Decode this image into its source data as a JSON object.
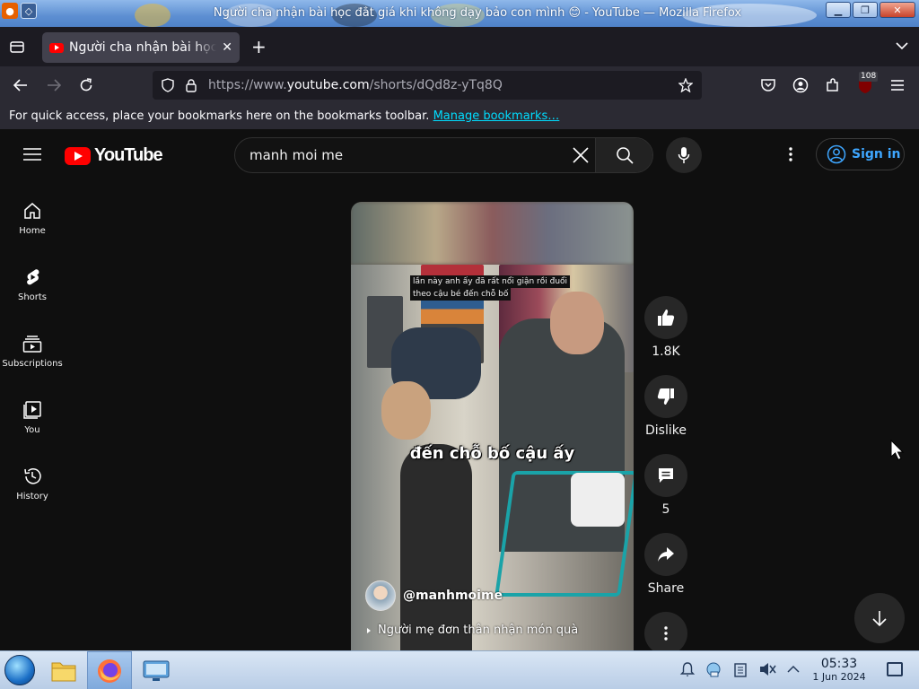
{
  "window": {
    "title": "Người cha nhận bài học đắt giá khi không dạy bảo con mình 😊 - YouTube — Mozilla Firefox"
  },
  "browser": {
    "tab_title": "Người cha nhận bài học đắt giá khi không dạy bảo con mình",
    "url_prefix": "https://www.",
    "url_domain": "youtube.com",
    "url_path": "/shorts/dQd8z-yTq8Q",
    "extensions_badge": "108",
    "bookmarks_message": "For quick access, place your bookmarks here on the bookmarks toolbar.",
    "bookmarks_link": "Manage bookmarks…"
  },
  "youtube": {
    "logo_text": "YouTube",
    "search_query": "manh moi me",
    "sign_in_label": "Sign in",
    "sidebar": [
      {
        "label": "Home",
        "icon": "home-icon"
      },
      {
        "label": "Shorts",
        "icon": "shorts-icon"
      },
      {
        "label": "Subscriptions",
        "icon": "subscriptions-icon"
      },
      {
        "label": "You",
        "icon": "you-icon"
      },
      {
        "label": "History",
        "icon": "history-icon"
      }
    ],
    "short": {
      "caption_line1": "lần này anh ấy đã rất nổi giận rồi đuổi",
      "caption_line2": "theo cậu bé đến chỗ bố",
      "big_caption": "đến chỗ bố cậu ấy",
      "channel": "@manhmoime",
      "title": "Người mẹ đơn thân nhận món quà"
    },
    "actions": {
      "like_count": "1.8K",
      "dislike_label": "Dislike",
      "comment_count": "5",
      "share_label": "Share"
    }
  },
  "taskbar": {
    "time": "05:33",
    "date": "1 Jun 2024"
  },
  "colors": {
    "yt_bg": "#0f0f0f",
    "yt_red": "#ff0000",
    "sign_in_blue": "#3ea6ff",
    "firefox_toolbar": "#2b2a33"
  }
}
